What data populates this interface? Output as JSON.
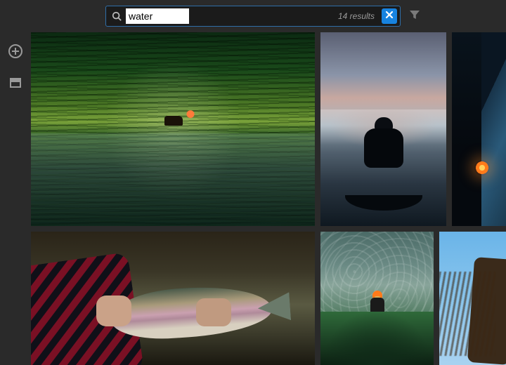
{
  "search": {
    "query": "water",
    "placeholder": "",
    "results_label": "14 results"
  },
  "icons": {
    "search": "search-icon",
    "clear": "close-icon",
    "filter": "funnel-icon",
    "add": "plus-circle-icon",
    "archive": "archive-icon"
  },
  "colors": {
    "accent": "#1783e0",
    "search_border": "#2f6ea8",
    "bg": "#2a2a2a"
  },
  "grid": {
    "rows": [
      [
        {
          "name": "photo-willow-pond"
        },
        {
          "name": "photo-canoe-dusk"
        },
        {
          "name": "photo-campfire-mountain"
        }
      ],
      [
        {
          "name": "photo-trout-catch"
        },
        {
          "name": "photo-river-wader"
        },
        {
          "name": "photo-sky-hair"
        }
      ]
    ]
  }
}
